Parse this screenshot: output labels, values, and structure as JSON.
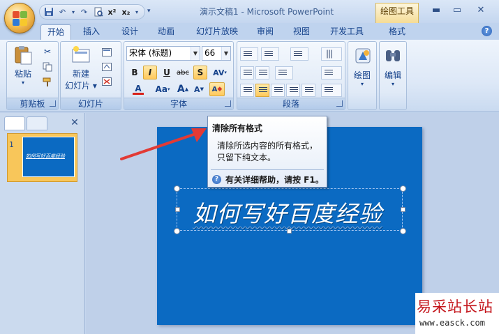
{
  "window": {
    "title": "演示文稿1 - Microsoft PowerPoint",
    "contextual_tab": "绘图工具",
    "minimize": "▬",
    "maximize": "▭",
    "close": "✕"
  },
  "quick_access": {
    "undo": "↶",
    "redo": "↷",
    "superscript": "x²",
    "subscript": "x₂",
    "more": "▾"
  },
  "tabs": [
    {
      "label": "开始",
      "active": true
    },
    {
      "label": "插入"
    },
    {
      "label": "设计"
    },
    {
      "label": "动画"
    },
    {
      "label": "幻灯片放映"
    },
    {
      "label": "审阅"
    },
    {
      "label": "视图"
    },
    {
      "label": "开发工具"
    },
    {
      "label": "格式"
    }
  ],
  "help": "?",
  "ribbon": {
    "clipboard": {
      "label": "剪贴板",
      "paste": "粘贴",
      "paste_arrow": "▾"
    },
    "slides": {
      "label": "幻灯片",
      "new_slide_1": "新建",
      "new_slide_2": "幻灯片 ▾"
    },
    "font": {
      "label": "字体",
      "font_name": "宋体 (标题)",
      "font_size": "66",
      "bold": "B",
      "italic": "I",
      "underline": "U",
      "strike": "abc",
      "shadow": "S",
      "spacing": "AV",
      "color": "A",
      "change_case": "Aa",
      "grow": "A",
      "shrink": "A",
      "clear": "A"
    },
    "paragraph": {
      "label": "段落"
    },
    "drawing": {
      "label": "绘图"
    },
    "editing": {
      "label": "编辑"
    }
  },
  "slide_pane": {
    "slide_number": "1",
    "thumb_text": "如何写好百度经验",
    "close": "✕"
  },
  "slide": {
    "title": "如何写好百度经验"
  },
  "tooltip": {
    "title": "清除所有格式",
    "line1": "清除所选内容的所有格式，",
    "line2": "只留下纯文本。",
    "help": "有关详细帮助，请按 F1。"
  },
  "watermark": {
    "cn": "易采站长站",
    "url": "www.easck.com"
  },
  "colors": {
    "accent": "#15428b",
    "slide_bg": "#0b6ac2",
    "arrow": "#e23a35",
    "highlight": "#ffc95c"
  }
}
